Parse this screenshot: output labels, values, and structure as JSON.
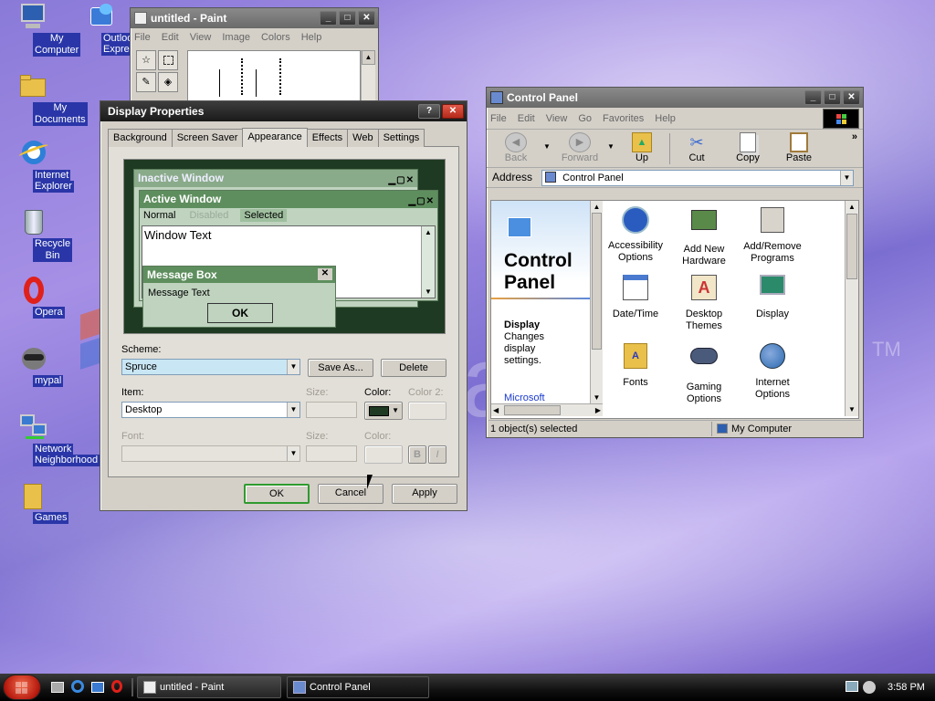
{
  "desktop": {
    "brand_text": "a",
    "brand_tm": "TM",
    "icons": [
      {
        "label_1": "My Computer",
        "label_2": ""
      },
      {
        "label_1": "Outlook",
        "label_2": "Express"
      },
      {
        "label_1": "My Documents",
        "label_2": ""
      },
      {
        "label_1": "Internet",
        "label_2": "Explorer"
      },
      {
        "label_1": "Recycle Bin",
        "label_2": ""
      },
      {
        "label_1": "Opera",
        "label_2": ""
      },
      {
        "label_1": "mypal",
        "label_2": ""
      },
      {
        "label_1": "Network",
        "label_2": "Neighborhood"
      },
      {
        "label_1": "Games",
        "label_2": ""
      }
    ]
  },
  "paint": {
    "title": "untitled - Paint",
    "menu": [
      "File",
      "Edit",
      "View",
      "Image",
      "Colors",
      "Help"
    ]
  },
  "display_props": {
    "title": "Display Properties",
    "help_btn": "?",
    "tabs": [
      "Background",
      "Screen Saver",
      "Appearance",
      "Effects",
      "Web",
      "Settings"
    ],
    "selected_tab": "Appearance",
    "preview": {
      "inactive_title": "Inactive Window",
      "active_title": "Active Window",
      "menu_normal": "Normal",
      "menu_disabled": "Disabled",
      "menu_selected": "Selected",
      "window_text": "Window Text",
      "msgbox_title": "Message Box",
      "msgbox_text": "Message Text",
      "msgbox_ok": "OK"
    },
    "scheme_label": "Scheme:",
    "scheme_value": "Spruce",
    "save_as": "Save As...",
    "delete": "Delete",
    "item_label": "Item:",
    "item_value": "Desktop",
    "size_label": "Size:",
    "color_label": "Color:",
    "color2_label": "Color 2:",
    "font_label": "Font:",
    "font_size_label": "Size:",
    "font_color_label": "Color:",
    "bold": "B",
    "italic": "I",
    "ok": "OK",
    "cancel": "Cancel",
    "apply": "Apply",
    "item_color": "#1f3a22"
  },
  "control_panel": {
    "title": "Control Panel",
    "menu": [
      "File",
      "Edit",
      "View",
      "Go",
      "Favorites",
      "Help"
    ],
    "toolbar": {
      "back": "Back",
      "forward": "Forward",
      "up": "Up",
      "cut": "Cut",
      "copy": "Copy",
      "paste": "Paste"
    },
    "address_label": "Address",
    "address_value": "Control Panel",
    "side_title_1": "Control",
    "side_title_2": "Panel",
    "side_item_title": "Display",
    "side_item_desc_1": "Changes",
    "side_item_desc_2": "display",
    "side_item_desc_3": "settings.",
    "side_link": "Microsoft",
    "items": [
      {
        "l1": "Accessibility",
        "l2": "Options"
      },
      {
        "l1": "Add New",
        "l2": "Hardware"
      },
      {
        "l1": "Add/Remove",
        "l2": "Programs"
      },
      {
        "l1": "Date/Time",
        "l2": ""
      },
      {
        "l1": "Desktop",
        "l2": "Themes"
      },
      {
        "l1": "Display",
        "l2": ""
      },
      {
        "l1": "Fonts",
        "l2": ""
      },
      {
        "l1": "Gaming",
        "l2": "Options"
      },
      {
        "l1": "Internet",
        "l2": "Options"
      }
    ],
    "status_left": "1 object(s) selected",
    "status_right": "My Computer"
  },
  "taskbar": {
    "tasks": [
      {
        "label": "untitled - Paint"
      },
      {
        "label": "Control Panel"
      }
    ],
    "clock": "3:58 PM"
  }
}
